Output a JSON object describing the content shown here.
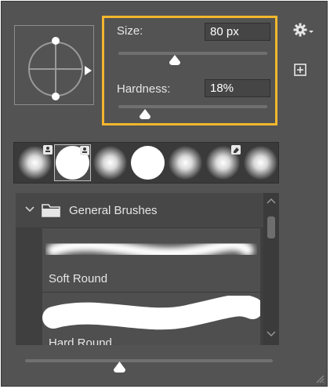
{
  "brush_settings": {
    "size_label": "Size:",
    "size_value": "80 px",
    "hardness_label": "Hardness:",
    "hardness_value": "18%",
    "size_slider_fraction": 0.38,
    "hardness_slider_fraction": 0.18,
    "highlight_color": "#f2b62e"
  },
  "toolbar": {
    "settings_icon": "gear-icon",
    "new_preset_icon": "new-preset-icon"
  },
  "brush_tips": [
    {
      "type": "soft",
      "badge": "stamp-icon"
    },
    {
      "type": "hard",
      "badge": "stamp-icon",
      "selected": true
    },
    {
      "type": "soft"
    },
    {
      "type": "hard"
    },
    {
      "type": "soft"
    },
    {
      "type": "soft",
      "badge": "eraser-icon"
    },
    {
      "type": "soft"
    }
  ],
  "presets": {
    "group_label": "General Brushes",
    "items": [
      {
        "name": "Soft Round"
      },
      {
        "name": "Hard Round"
      }
    ]
  },
  "preview_size_fraction": 0.38
}
